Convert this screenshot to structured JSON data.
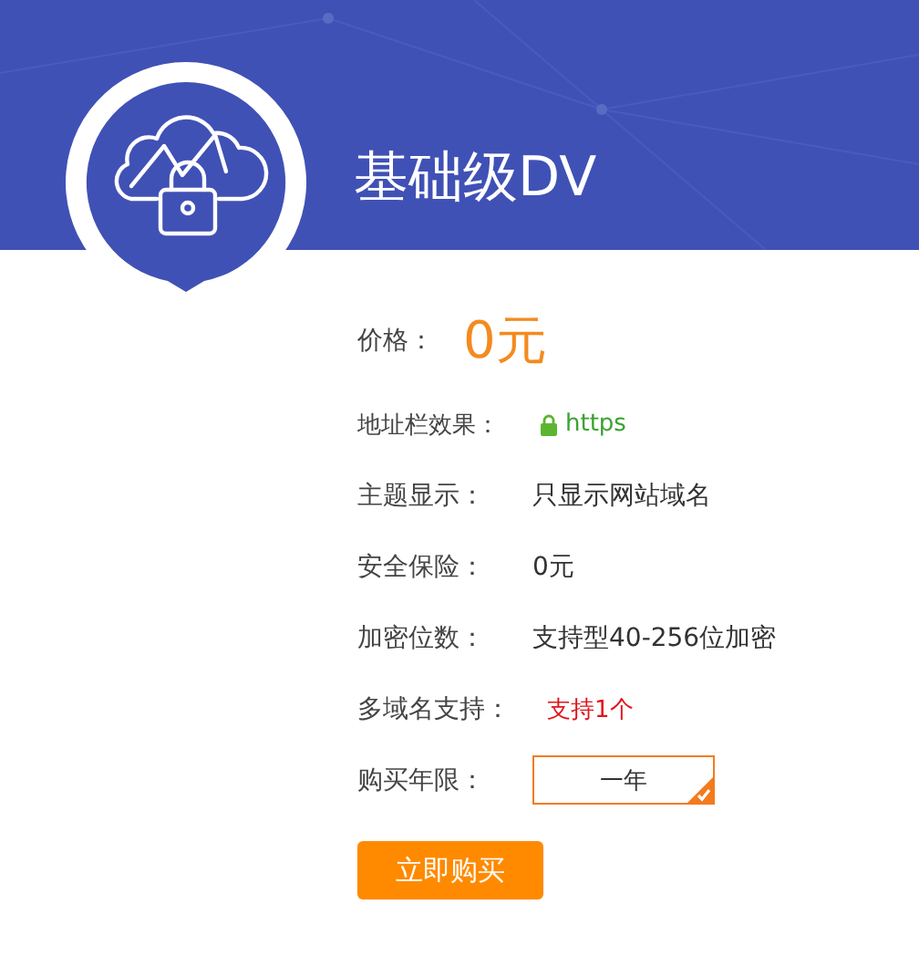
{
  "header": {
    "title": "基础级DV"
  },
  "rows": [
    {
      "kind": "price",
      "label": "价格：",
      "value": "0元"
    },
    {
      "kind": "secure",
      "label": "地址栏效果：",
      "value": "https"
    },
    {
      "kind": "plain",
      "label": "主题显示：",
      "value": "只显示网站域名"
    },
    {
      "kind": "plain",
      "label": "安全保险：",
      "value": "0元"
    },
    {
      "kind": "plain",
      "label": "加密位数：",
      "value": "支持型40-256位加密"
    },
    {
      "kind": "highlight",
      "label": "多域名支持：",
      "value": "支持1个"
    },
    {
      "kind": "option",
      "label": "购买年限：",
      "value": "一年",
      "selected": true
    }
  ],
  "buy_button": "立即购买"
}
